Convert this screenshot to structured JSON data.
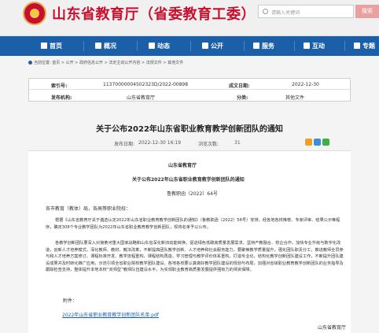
{
  "header": {
    "site_title": "山东省教育厅（省委教育工委）",
    "search_placeholder": "请输入关键词",
    "search_button": "搜索"
  },
  "nav": [
    {
      "label": "首页",
      "icon": "home-icon"
    },
    {
      "label": "概况",
      "icon": "overview-icon"
    },
    {
      "label": "动态",
      "icon": "news-icon"
    },
    {
      "label": "公开",
      "icon": "disclosure-icon"
    },
    {
      "label": "服务",
      "icon": "service-icon"
    },
    {
      "label": "互动",
      "icon": "interaction-icon"
    },
    {
      "label": "专题",
      "icon": "topic-icon"
    }
  ],
  "breadcrumb": "当前位置: 首页 > 公开 > 政府信息公开 > 法定主动公开内容 > 法规文件 > 其他文件",
  "meta": {
    "index_label": "索引号:",
    "index_value": "11370000004502323D/2022-00898",
    "date_label": "成文日期:",
    "date_value": "2022-12-30",
    "org_label": "发布机构:",
    "org_value": "山东省教育厅",
    "category_label": "分类:",
    "category_value": "其他文件"
  },
  "article": {
    "title": "关于公布2022年山东省职业教育教学创新团队的通知",
    "publish_label": "发布日期:",
    "publish_value": "2022-12-30 16:19",
    "views_label": "浏览次数:",
    "views_value": "31",
    "issuer": "山东省教育厅",
    "doc_title": "关于公布2022年山东省职业教育教学创新团队的通知",
    "doc_number": "鲁教职函（2022）64号",
    "salutation": "各市教育（教体）局，各高等职业院校：",
    "para1": "根据《山东省教育厅关于遴选认定2022年山东省职业教育教学创新团队的通知》（鲁教职函〔2022〕56号）安排，经各地各校推荐、专家评审、结果公示等程序，确定308个专业教学团队为2022年山东省职业教育教学创新团队，现将名单予以公布。",
    "para2": "各教学创新团队要深入对接黄河重大国家战略和山东省深化新旧动能转换，促进绿色低碳高质量发展需求，坚持产教融合、校企合作，加快专业升级与数字化改造，创新人才培养模式，深化教师、教材、教法改革，不断提高团队教学创新、人才培养和社会服务能力，要聚焦教学质量提升，强化团队职责分工，推进教师全员参与和人才培养方案修订、课程标准开发、教学流程重构、课程结构再造、学习管理与教学评价体系重构，打造专业化、结构化教学创新团队建设工作，不断提升团队建设成果并及时转化推广应用，示范引领全省职业院校教学团队建设。各地各校要认真做好教学团队建设的规划与布局，加强对省级职业教育教学创新团队的业务指导及跟踪检查支持，整体提升本地本校“双师型”教师队伍建设水平，为实现职业教育高质量发展提供强有力的师资保障。",
    "attachment_label": "附件：",
    "attachment_file": "2022年山东省职业教育教学创新团队名单.pdf",
    "signature": "山东省教育厅"
  }
}
